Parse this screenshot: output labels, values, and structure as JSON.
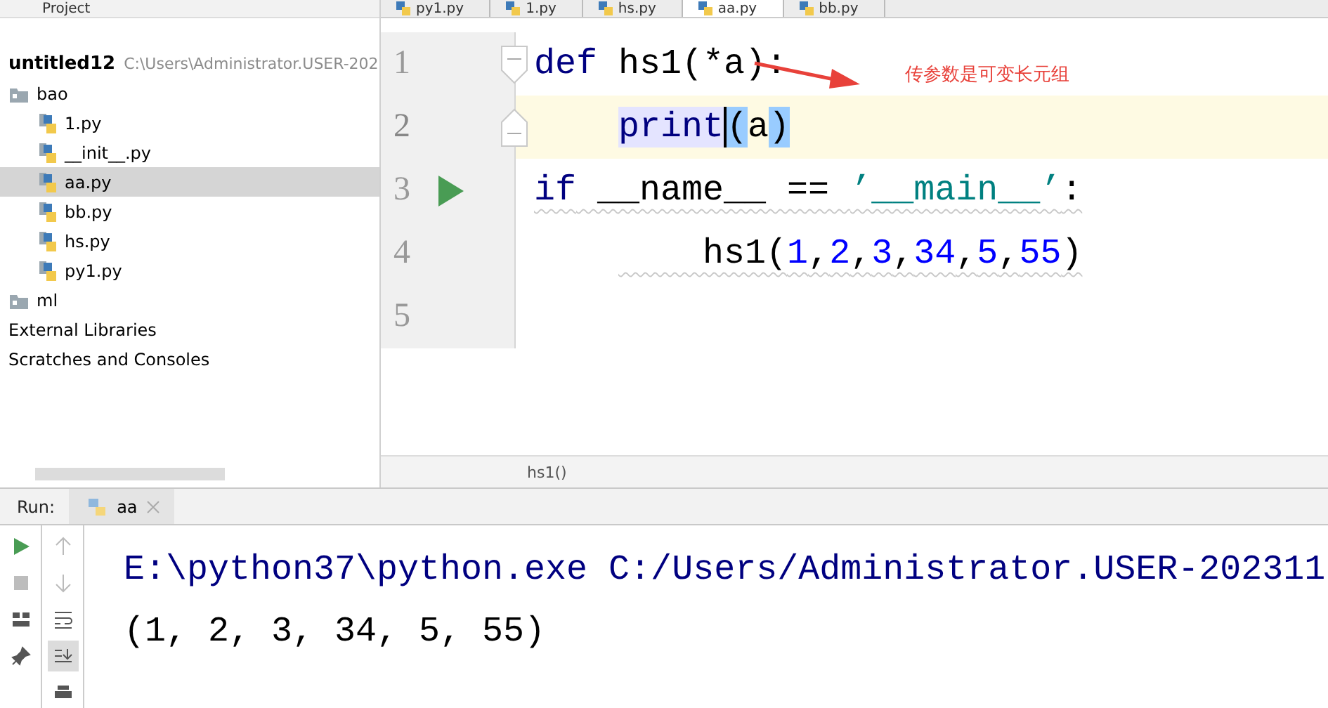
{
  "project_panel": {
    "title": "Project",
    "tree": [
      {
        "label": "untitled12",
        "path": "C:\\Users\\Administrator.USER-202",
        "kind": "root",
        "selected": false,
        "children": [
          {
            "label": "bao",
            "kind": "folder",
            "selected": false,
            "children": [
              {
                "label": "1.py",
                "kind": "file",
                "selected": false
              },
              {
                "label": "__init__.py",
                "kind": "file",
                "selected": false
              },
              {
                "label": "aa.py",
                "kind": "file",
                "selected": true
              },
              {
                "label": "bb.py",
                "kind": "file",
                "selected": false
              },
              {
                "label": "hs.py",
                "kind": "file",
                "selected": false
              },
              {
                "label": "py1.py",
                "kind": "file",
                "selected": false
              }
            ]
          },
          {
            "label": "ml",
            "kind": "folder",
            "selected": false
          }
        ]
      },
      {
        "label": "External Libraries",
        "kind": "plain",
        "selected": false
      },
      {
        "label": "Scratches and Consoles",
        "kind": "plain",
        "selected": false
      }
    ]
  },
  "editor_tabs": [
    {
      "label": "py1.py",
      "selected": false
    },
    {
      "label": "1.py",
      "selected": false
    },
    {
      "label": "hs.py",
      "selected": false
    },
    {
      "label": "aa.py",
      "selected": true
    },
    {
      "label": "bb.py",
      "selected": false
    }
  ],
  "code_lines": [
    {
      "number": "1",
      "kind": "fold-start",
      "current": false,
      "wavy": false,
      "tokens": [
        {
          "text": "def",
          "kind": "keyword"
        },
        {
          "text": " hs1(*a):",
          "kind": "plain"
        }
      ],
      "children": [
        {
          "number": "2",
          "kind": "fold-end",
          "current": true,
          "wavy": false,
          "tokens": [
            {
              "text": "print",
              "kind": "usage"
            },
            {
              "text": "(",
              "kind": "bracket"
            },
            {
              "text": "a",
              "kind": "plain"
            },
            {
              "text": ")",
              "kind": "bracket"
            }
          ]
        }
      ]
    },
    {
      "number": "3",
      "kind": "run",
      "current": false,
      "wavy": true,
      "tokens": [
        {
          "text": "if",
          "kind": "keyword"
        },
        {
          "text": " __name__ == ",
          "kind": "plain"
        },
        {
          "text": "’__main__’",
          "kind": "string"
        },
        {
          "text": ":",
          "kind": "plain"
        }
      ],
      "children": [
        {
          "number": "4",
          "kind": "plain",
          "current": false,
          "wavy": true,
          "tokens": [
            {
              "text": "    hs1(",
              "kind": "plain"
            },
            {
              "text": "1",
              "kind": "number"
            },
            {
              "text": ",",
              "kind": "plain"
            },
            {
              "text": "2",
              "kind": "number"
            },
            {
              "text": ",",
              "kind": "plain"
            },
            {
              "text": "3",
              "kind": "number"
            },
            {
              "text": ",",
              "kind": "plain"
            },
            {
              "text": "34",
              "kind": "number"
            },
            {
              "text": ",",
              "kind": "plain"
            },
            {
              "text": "5",
              "kind": "number"
            },
            {
              "text": ",",
              "kind": "plain"
            },
            {
              "text": "55",
              "kind": "number"
            },
            {
              "text": ")",
              "kind": "plain"
            }
          ]
        }
      ]
    },
    {
      "number": "5",
      "kind": "plain",
      "current": false
    }
  ],
  "annotation": {
    "text": "传参数是可变长元组"
  },
  "breadcrumb": "hs1()",
  "run_panel": {
    "label": "Run:",
    "tab": {
      "label": "aa",
      "selected": true
    },
    "console": [
      {
        "text": "E:\\python37\\python.exe C:/Users/Administrator.USER-202311",
        "kind": "command"
      },
      {
        "text": "(1, 2, 3, 34, 5, 55)",
        "kind": "output"
      }
    ]
  }
}
